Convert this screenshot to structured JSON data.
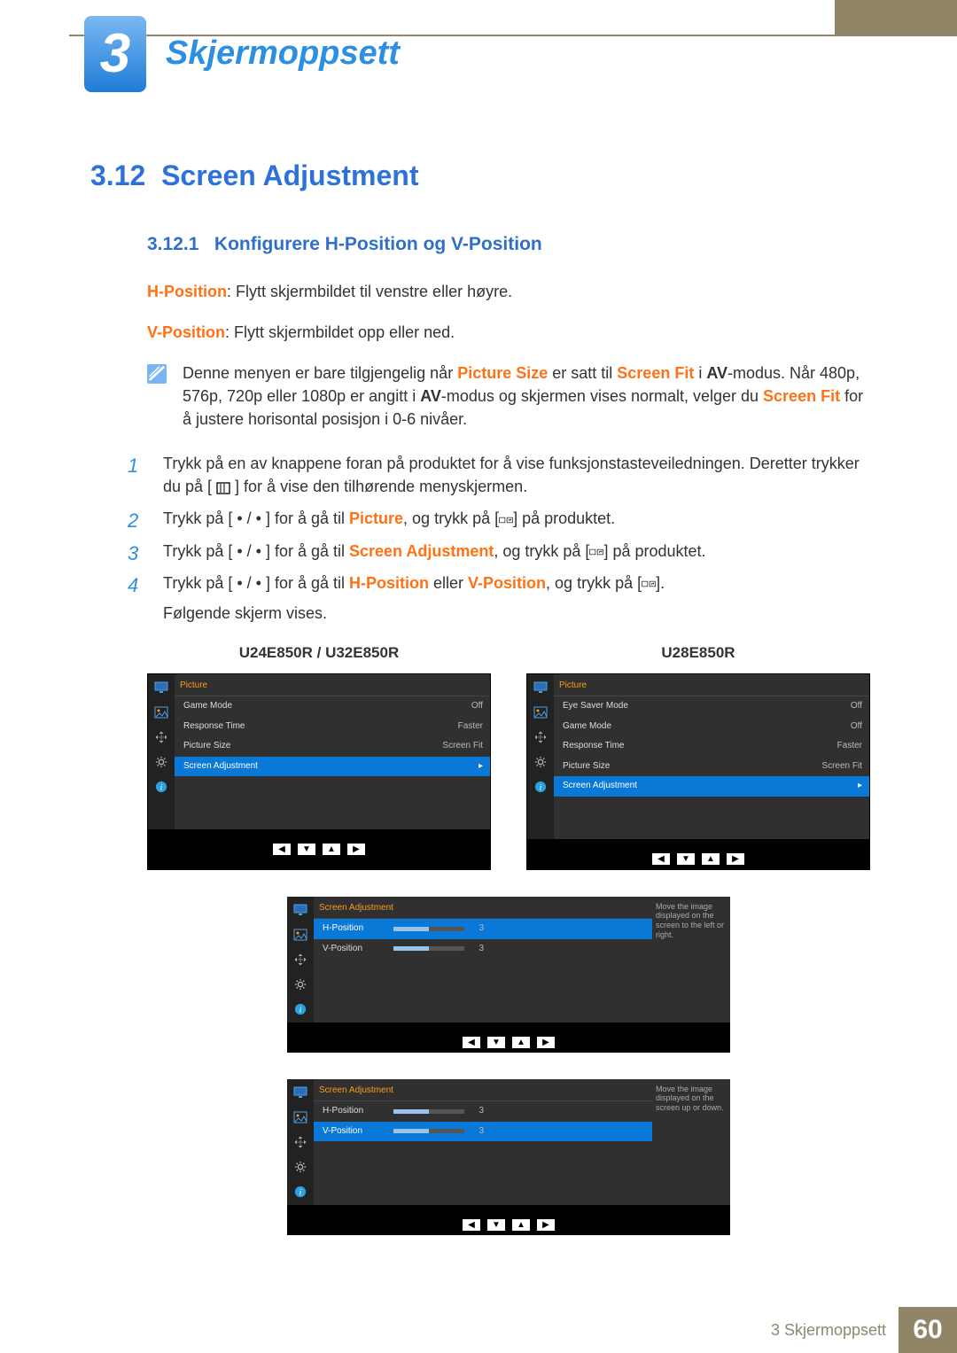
{
  "chapter": {
    "number": "3",
    "title": "Skjermoppsett"
  },
  "section": {
    "number": "3.12",
    "title": "Screen Adjustment"
  },
  "subsection": {
    "number": "3.12.1",
    "title": "Konfigurere H-Position og V-Position"
  },
  "intro": {
    "h_label": "H-Position",
    "h_text": ": Flytt skjermbildet til venstre eller høyre.",
    "v_label": "V-Position",
    "v_text": ": Flytt skjermbildet opp eller ned."
  },
  "note": {
    "p1_a": "Denne menyen er bare tilgjengelig når ",
    "p1_b": "Picture Size",
    "p1_c": " er satt til ",
    "p1_d": "Screen Fit",
    "p1_e": " i ",
    "p1_f": "AV",
    "p1_g": "-modus. Når 480p, 576p, 720p eller 1080p er angitt i ",
    "p1_h": "AV",
    "p1_i": "-modus og skjermen vises normalt, velger du ",
    "p1_j": "Screen Fit",
    "p1_k": " for å justere horisontal posisjon i 0-6 nivåer."
  },
  "steps": {
    "s1a": "Trykk på en av knappene foran på produktet for å vise funksjonstasteveiledningen. Deretter trykker du på [ ",
    "s1b": " ] for å vise den tilhørende menyskjermen.",
    "s2a": "Trykk på [ ",
    "s2b": " ] for å gå til ",
    "s2c": "Picture",
    "s2d": ", og trykk på [",
    "s2e": "] på produktet.",
    "s3a": "Trykk på [ ",
    "s3b": " ] for å gå til ",
    "s3c": "Screen Adjustment",
    "s3d": ", og trykk på [",
    "s3e": "] på produktet.",
    "s4a": "Trykk på [ ",
    "s4b": " ] for å gå til ",
    "s4c": "H-Position",
    "s4d": " eller ",
    "s4e": "V-Position",
    "s4f": ", og trykk på [",
    "s4g": "].",
    "s4h": "Følgende skjerm vises."
  },
  "osd_titles": {
    "left": "U24E850R / U32E850R",
    "right": "U28E850R"
  },
  "osd_left": {
    "head": "Picture",
    "rows": [
      {
        "name": "Game Mode",
        "val": "Off"
      },
      {
        "name": "Response Time",
        "val": "Faster"
      },
      {
        "name": "Picture Size",
        "val": "Screen Fit"
      },
      {
        "name": "Screen Adjustment",
        "val": "▸",
        "hl": true
      }
    ]
  },
  "osd_right": {
    "head": "Picture",
    "rows": [
      {
        "name": "Eye Saver Mode",
        "val": "Off"
      },
      {
        "name": "Game Mode",
        "val": "Off"
      },
      {
        "name": "Response Time",
        "val": "Faster"
      },
      {
        "name": "Picture Size",
        "val": "Screen Fit"
      },
      {
        "name": "Screen Adjustment",
        "val": "▸",
        "hl": true
      }
    ]
  },
  "osd_h": {
    "head": "Screen Adjustment",
    "rows": [
      {
        "name": "H-Position",
        "val": "3",
        "hl": true
      },
      {
        "name": "V-Position",
        "val": "3"
      }
    ],
    "desc": "Move the image displayed on the screen to the left or right."
  },
  "osd_v": {
    "head": "Screen Adjustment",
    "rows": [
      {
        "name": "H-Position",
        "val": "3"
      },
      {
        "name": "V-Position",
        "val": "3",
        "hl": true
      }
    ],
    "desc": "Move the image displayed on the screen up or down."
  },
  "nav_glyphs": [
    "◀",
    "▼",
    "▲",
    "▶"
  ],
  "footer": {
    "text": "3 Skjermoppsett",
    "page": "60"
  }
}
